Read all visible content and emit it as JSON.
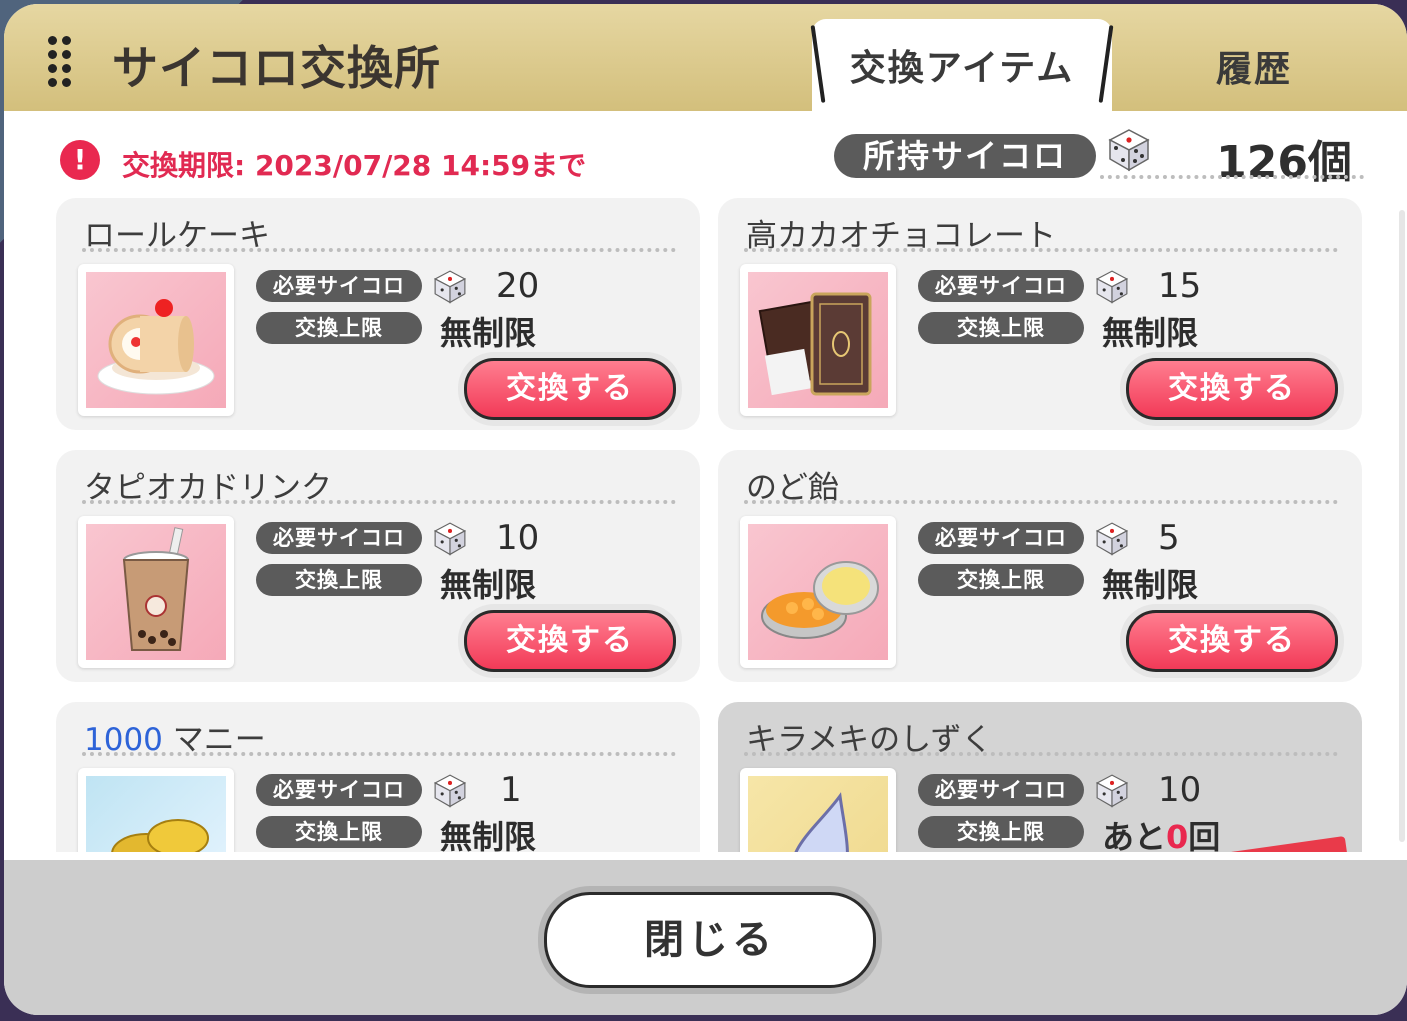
{
  "header": {
    "title": "サイコロ交換所",
    "tabs": [
      {
        "label": "交換アイテム",
        "active": true
      },
      {
        "label": "履歴",
        "active": false
      }
    ]
  },
  "deadline": {
    "icon": "alert-icon",
    "text": "交換期限: 2023/07/28 14:59まで",
    "color": "#e12a52"
  },
  "owned": {
    "label": "所持サイコロ",
    "value": "126個",
    "icon": "dice-icon"
  },
  "items": [
    {
      "name": "ロールケーキ",
      "required_label": "必要サイコロ",
      "cost": "20",
      "limit_label": "交換上限",
      "limit": "無制限",
      "button": "交換する",
      "thumb_icon": "roll-cake-icon"
    },
    {
      "name": "高カカオチョコレート",
      "required_label": "必要サイコロ",
      "cost": "15",
      "limit_label": "交換上限",
      "limit": "無制限",
      "button": "交換する",
      "thumb_icon": "chocolate-icon"
    },
    {
      "name": "タピオカドリンク",
      "required_label": "必要サイコロ",
      "cost": "10",
      "limit_label": "交換上限",
      "limit": "無制限",
      "button": "交換する",
      "thumb_icon": "tapioca-drink-icon"
    },
    {
      "name": "のど飴",
      "required_label": "必要サイコロ",
      "cost": "5",
      "limit_label": "交換上限",
      "limit": "無制限",
      "button": "交換する",
      "thumb_icon": "throat-candy-icon"
    },
    {
      "name_number": "1000",
      "name_suffix": " マニー",
      "required_label": "必要サイコロ",
      "cost": "1",
      "limit_label": "交換上限",
      "limit": "無制限",
      "thumb_icon": "coins-icon"
    },
    {
      "name": "キラメキのしずく",
      "required_label": "必要サイコロ",
      "cost": "10",
      "limit_label": "交換上限",
      "limit_prefix": "あと",
      "limit_count": "0",
      "limit_suffix": "回",
      "thumb_icon": "drop-icon",
      "sold_out": true
    }
  ],
  "footer": {
    "close_label": "閉じる"
  },
  "colors": {
    "accent": "#f23a58",
    "header_gold": "#d3bf7c",
    "highlight_number": "#2d63d8"
  }
}
